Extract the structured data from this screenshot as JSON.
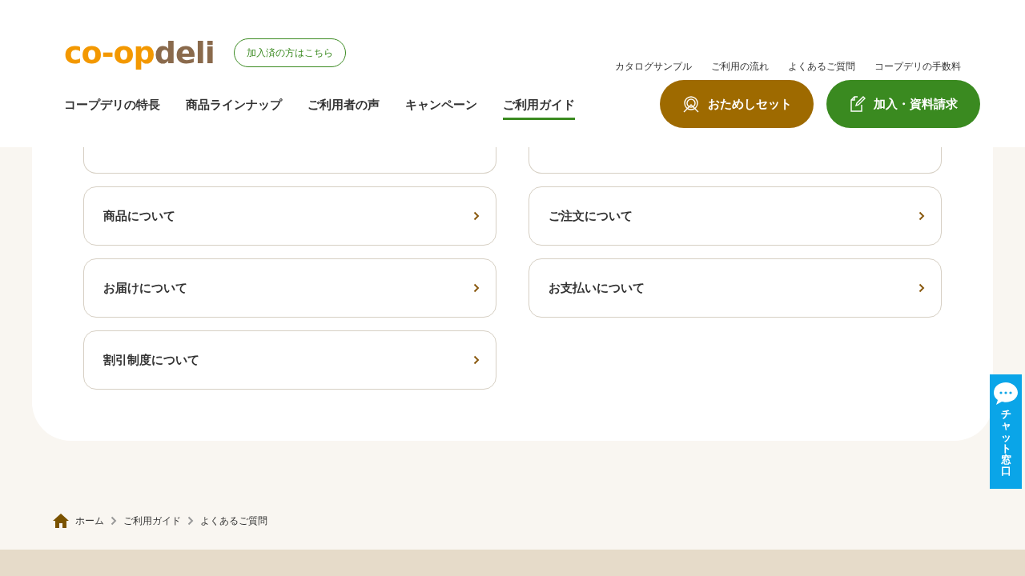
{
  "header": {
    "logo": [
      {
        "text": "co-op",
        "color": "#f39800"
      },
      {
        "text": "deli",
        "color": "#8a6a4c"
      }
    ],
    "member_link": "加入済の方はこちら",
    "utility_links": [
      "カタログサンプル",
      "ご利用の流れ",
      "よくあるご質問",
      "コープデリの手数料"
    ],
    "nav": [
      {
        "label": "コープデリの特長",
        "selected": false
      },
      {
        "label": "商品ラインナップ",
        "selected": false
      },
      {
        "label": "ご利用者の声",
        "selected": false
      },
      {
        "label": "キャンペーン",
        "selected": false
      },
      {
        "label": "ご利用ガイド",
        "selected": true
      }
    ],
    "actions": [
      {
        "kind": "trial",
        "label": "おためしセット"
      },
      {
        "kind": "join",
        "label": "加入・資料請求"
      }
    ]
  },
  "faq_categories": [
    {
      "kind": "covered"
    },
    {
      "kind": "covered"
    },
    {
      "kind": "card",
      "label": "商品について"
    },
    {
      "kind": "card",
      "label": "ご注文について"
    },
    {
      "kind": "card",
      "label": "お届けについて"
    },
    {
      "kind": "card",
      "label": "お支払いについて"
    },
    {
      "kind": "card",
      "label": "割引制度について"
    }
  ],
  "chat_tab": {
    "label": "チャット窓口"
  },
  "breadcrumb": [
    "ホーム",
    "ご利用ガイド",
    "よくあるご質問"
  ]
}
